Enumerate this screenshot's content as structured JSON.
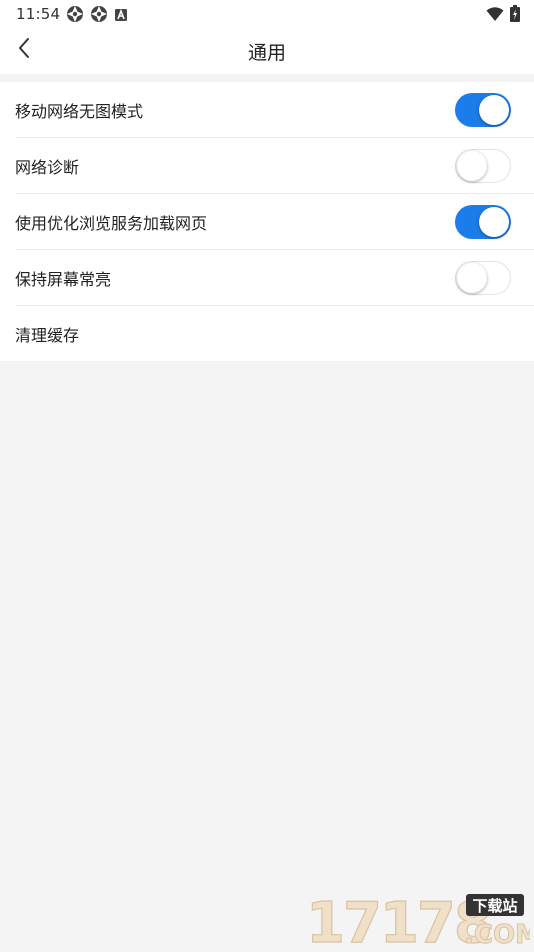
{
  "status_bar": {
    "time": "11:54",
    "left_icons": [
      "aperture-icon",
      "aperture-icon",
      "a-letter-icon"
    ],
    "right_icons": [
      "wifi-icon",
      "battery-icon"
    ]
  },
  "header": {
    "title": "通用",
    "back_icon": "chevron-left-icon"
  },
  "settings": [
    {
      "label": "移动网络无图模式",
      "has_toggle": true,
      "toggle_on": true
    },
    {
      "label": "网络诊断",
      "has_toggle": true,
      "toggle_on": false
    },
    {
      "label": "使用优化浏览服务加载网页",
      "has_toggle": true,
      "toggle_on": true
    },
    {
      "label": "保持屏幕常亮",
      "has_toggle": true,
      "toggle_on": false
    },
    {
      "label": "清理缓存",
      "has_toggle": false
    }
  ],
  "watermark": {
    "number": "17178",
    "badge": "下载站",
    "domain": "COM"
  },
  "colors": {
    "accent": "#1a7de9",
    "background": "#f4f4f4",
    "surface": "#ffffff",
    "divider": "#ececec",
    "watermark_number": "#f0e0c8",
    "watermark_badge": "#333333"
  }
}
